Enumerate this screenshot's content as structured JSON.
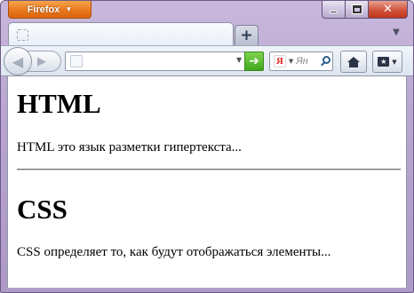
{
  "app_menu": {
    "label": "Firefox"
  },
  "window_controls": {
    "minimize": "minimize",
    "maximize": "maximize",
    "close": "close"
  },
  "tab": {
    "title": ""
  },
  "new_tab": {
    "label": "+"
  },
  "urlbar": {
    "value": "",
    "placeholder": ""
  },
  "searchbar": {
    "engine_logo": "Я",
    "placeholder": "Ян",
    "value": ""
  },
  "page": {
    "heading1": "HTML",
    "paragraph1": "HTML это язык разметки гипертекста...",
    "heading2": "CSS",
    "paragraph2": "CSS определяет то, как будут отображаться элементы..."
  },
  "colors": {
    "app_button": "#e8761a",
    "window_frame": "#b9a5d0",
    "close_button": "#c2341a",
    "go_button": "#3fa81c"
  },
  "icons": [
    "firefox-menu-arrow-icon",
    "minimize-icon",
    "maximize-icon",
    "close-icon",
    "tab-favicon-icon",
    "plus-icon",
    "tab-list-chevron-icon",
    "back-arrow-icon",
    "forward-arrow-icon",
    "site-identity-icon",
    "url-dropdown-icon",
    "go-arrow-icon",
    "yandex-icon",
    "search-engine-dropdown-icon",
    "magnifier-icon",
    "home-icon",
    "bookmarks-icon"
  ]
}
